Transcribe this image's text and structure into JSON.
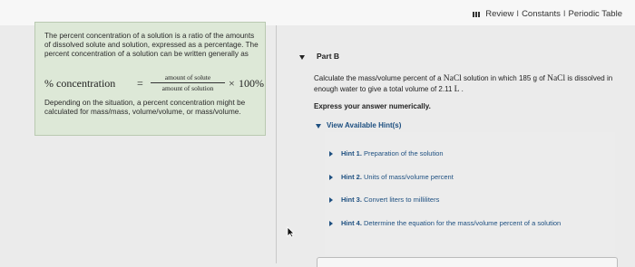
{
  "header": {
    "links": [
      "Review",
      "Constants",
      "Periodic Table"
    ],
    "separator": "I"
  },
  "intro": {
    "paragraph1": "The percent concentration of a solution is a ratio of the amounts of dissolved solute and solution, expressed as a percentage. The percent concentration of a solution can be written generally as",
    "formula": {
      "lhs": "% concentration",
      "equals": "=",
      "numerator": "amount of solute",
      "denominator": "amount of solution",
      "times": "×",
      "rhs": "100%"
    },
    "paragraph2": "Depending on the situation, a percent concentration might be calculated for mass/mass, volume/volume, or mass/volume."
  },
  "part": {
    "title": "Part B",
    "question": {
      "t1": "Calculate the mass/volume percent of a ",
      "c1": "NaCl",
      "t2": " solution in which 185 g of ",
      "c2": "NaCl",
      "t3": " is dissolved in enough water to give a total volume of 2.11 ",
      "c3": "L",
      "t4": " ."
    },
    "instruction": "Express your answer numerically.",
    "hints_label": "View Available Hint(s)",
    "hints": [
      {
        "num": "Hint 1.",
        "text": " Preparation of the solution"
      },
      {
        "num": "Hint 2.",
        "text": " Units of mass/volume percent"
      },
      {
        "num": "Hint 3.",
        "text": " Convert liters to milliliters"
      },
      {
        "num": "Hint 4.",
        "text": " Determine the equation for the mass/volume percent of a solution"
      }
    ]
  }
}
